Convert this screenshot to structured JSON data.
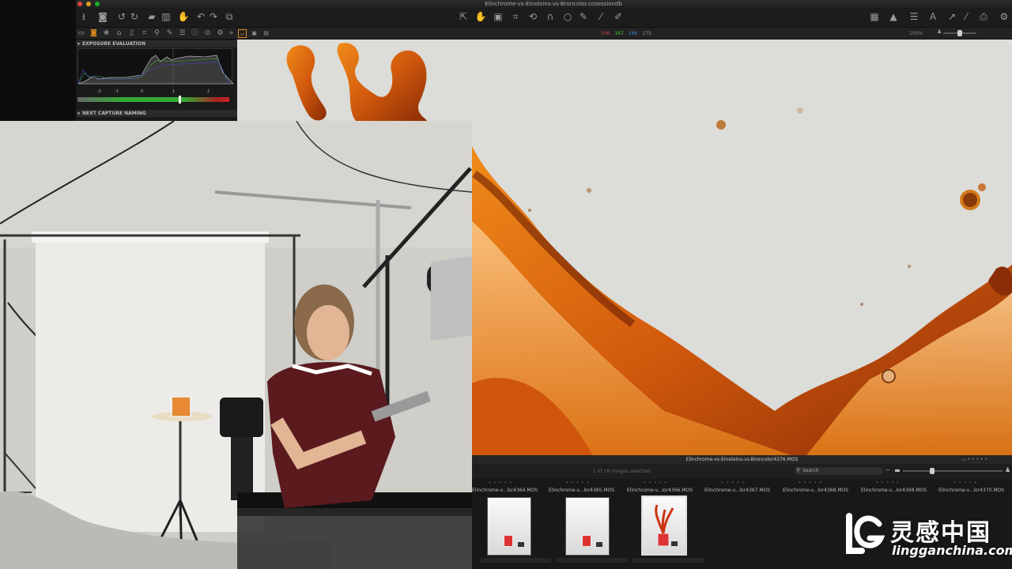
{
  "window": {
    "title": "Elinchrome-vs-Einsteins-vs-Broncolor.cosessiondb"
  },
  "traffic_colors": [
    "#e0443e",
    "#dea123",
    "#1aab29"
  ],
  "toolbar": {
    "left_icons": [
      "import-icon",
      "camera-icon",
      "rotate-left-icon",
      "rotate-right-icon",
      "folder-icon",
      "trash-icon",
      "hand-icon",
      "undo-icon",
      "redo-icon",
      "stack-icon"
    ],
    "center_icons": [
      "pointer-icon",
      "pan-icon",
      "crop-frame-icon",
      "crop-icon",
      "rotate-icon",
      "keystone-icon",
      "circle-icon",
      "brush-icon",
      "picker-icon",
      "eraser-icon"
    ],
    "right_icons": [
      "grid-icon",
      "warning-icon",
      "list-icon",
      "text-icon",
      "arrow-icon",
      "pen-icon",
      "print-icon",
      "settings-icon"
    ]
  },
  "tool_tabs": [
    "library-tab",
    "capture-tab",
    "color-tab",
    "exposure-tab",
    "lens-tab",
    "crop-tab",
    "search-tab",
    "pen-tab",
    "list-tab",
    "info-tab",
    "output-tab",
    "settings-tab"
  ],
  "rgb_readout": {
    "r": "106",
    "g": "167",
    "b": "166",
    "l": "175",
    "colors": [
      "#c44",
      "#4c4",
      "#48c",
      "#999"
    ]
  },
  "zoom": "100%",
  "panels": {
    "exposure_evaluation": "EXPOSURE EVALUATION",
    "next_capture_naming": "NEXT CAPTURE NAMING",
    "scale": [
      "-2",
      "-1",
      "0",
      "1",
      "2"
    ]
  },
  "browser": {
    "current_file": "Elinchrome-vs-Einsteins-vs-Broncolor4376.MOS",
    "selected_text": "1 of 18 images selected",
    "search_placeholder": "Search",
    "files": [
      "Elinchrome-v...lor4364.MOS",
      "Elinchrome-v...lor4365.MOS",
      "Elinchrome-v...lor4366.MOS",
      "Elinchrome-v...lor4367.MOS",
      "Elinchrome-v...lor4368.MOS",
      "Elinchrome-v...lor4369.MOS",
      "Elinchrome-v...lor4370.MOS"
    ],
    "stars": "• • • • •"
  },
  "watermark": {
    "cn": "灵感中国",
    "en": "lingganchina.com"
  }
}
